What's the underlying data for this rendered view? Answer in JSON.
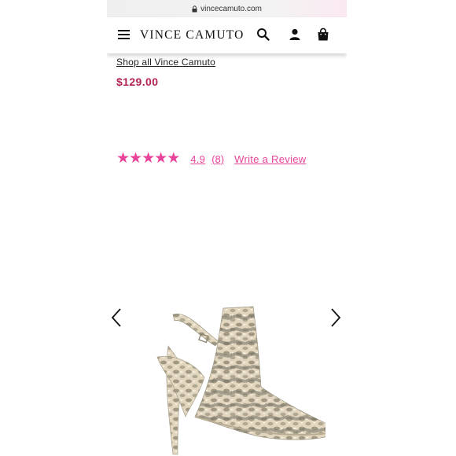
{
  "browser": {
    "url": "vincecamuto.com"
  },
  "header": {
    "brand": "VINCE CAMUTO"
  },
  "product": {
    "shop_all_link": "Shop all Vince Camuto",
    "price": "$129.00",
    "rating": {
      "stars_filled": 5,
      "stars_total": 5,
      "value_text": "4.9",
      "count_text": "(8)",
      "write_review": "Write a Review"
    },
    "image": {
      "icon": "snakeskin-pump-image"
    }
  },
  "colors": {
    "accent_pink": "#e8439a",
    "price_red": "#b02352"
  }
}
